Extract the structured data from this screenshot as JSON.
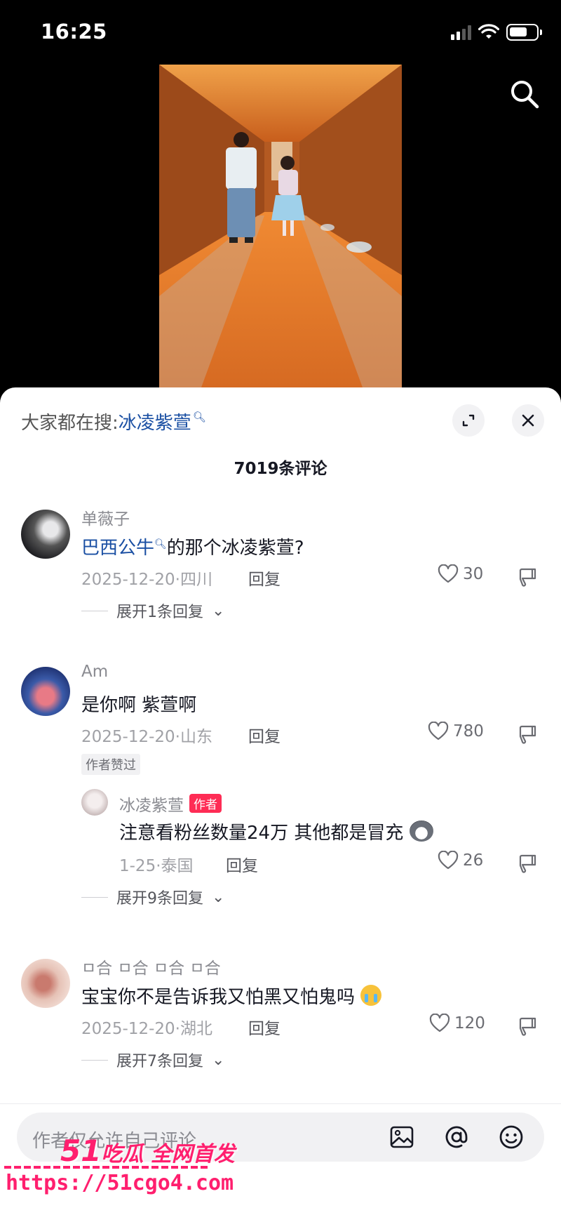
{
  "status_bar": {
    "time": "16:25"
  },
  "video": {
    "icon": "search-icon"
  },
  "sheet": {
    "trend_prefix": "大家都在搜:",
    "trend_keyword": "冰凌紫萱",
    "comment_count": "7019条评论",
    "icons": [
      "expand-icon",
      "close-icon"
    ]
  },
  "comments": [
    {
      "user": "单薇子",
      "mention": "巴西公牛",
      "text": "的那个冰凌紫萱?",
      "meta": "2025-12-20·四川",
      "reply": "回复",
      "likes": "30",
      "expand": "展开1条回复"
    },
    {
      "user": "Am",
      "text": "是你啊 紫萱啊",
      "meta": "2025-12-20·山东",
      "reply": "回复",
      "likes": "780",
      "badge": "作者赞过",
      "sub_reply": {
        "user": "冰凌紫萱",
        "tag": "作者",
        "text": "注意看粉丝数量24万 其他都是冒充",
        "meta": "1-25·泰国",
        "reply": "回复",
        "likes": "26"
      },
      "expand": "展开9条回复"
    },
    {
      "user": "ㅁ合 ㅁ合 ㅁ合 ㅁ合",
      "text": "宝宝你不是告诉我又怕黑又怕鬼吗",
      "meta": "2025-12-20·湖北",
      "reply": "回复",
      "likes": "120",
      "expand": "展开7条回复"
    }
  ],
  "input": {
    "placeholder": "作者仅允许自己评论",
    "icons": [
      "image-icon",
      "at-icon",
      "emoji-icon"
    ]
  },
  "watermark": {
    "logo_num": "51",
    "logo_text": "吃瓜 全网首发",
    "url": "https://51cgo4.com"
  },
  "colors": {
    "accent": "#fe2c55",
    "link": "#1a4fa3",
    "watermark": "#ff1f6e"
  }
}
